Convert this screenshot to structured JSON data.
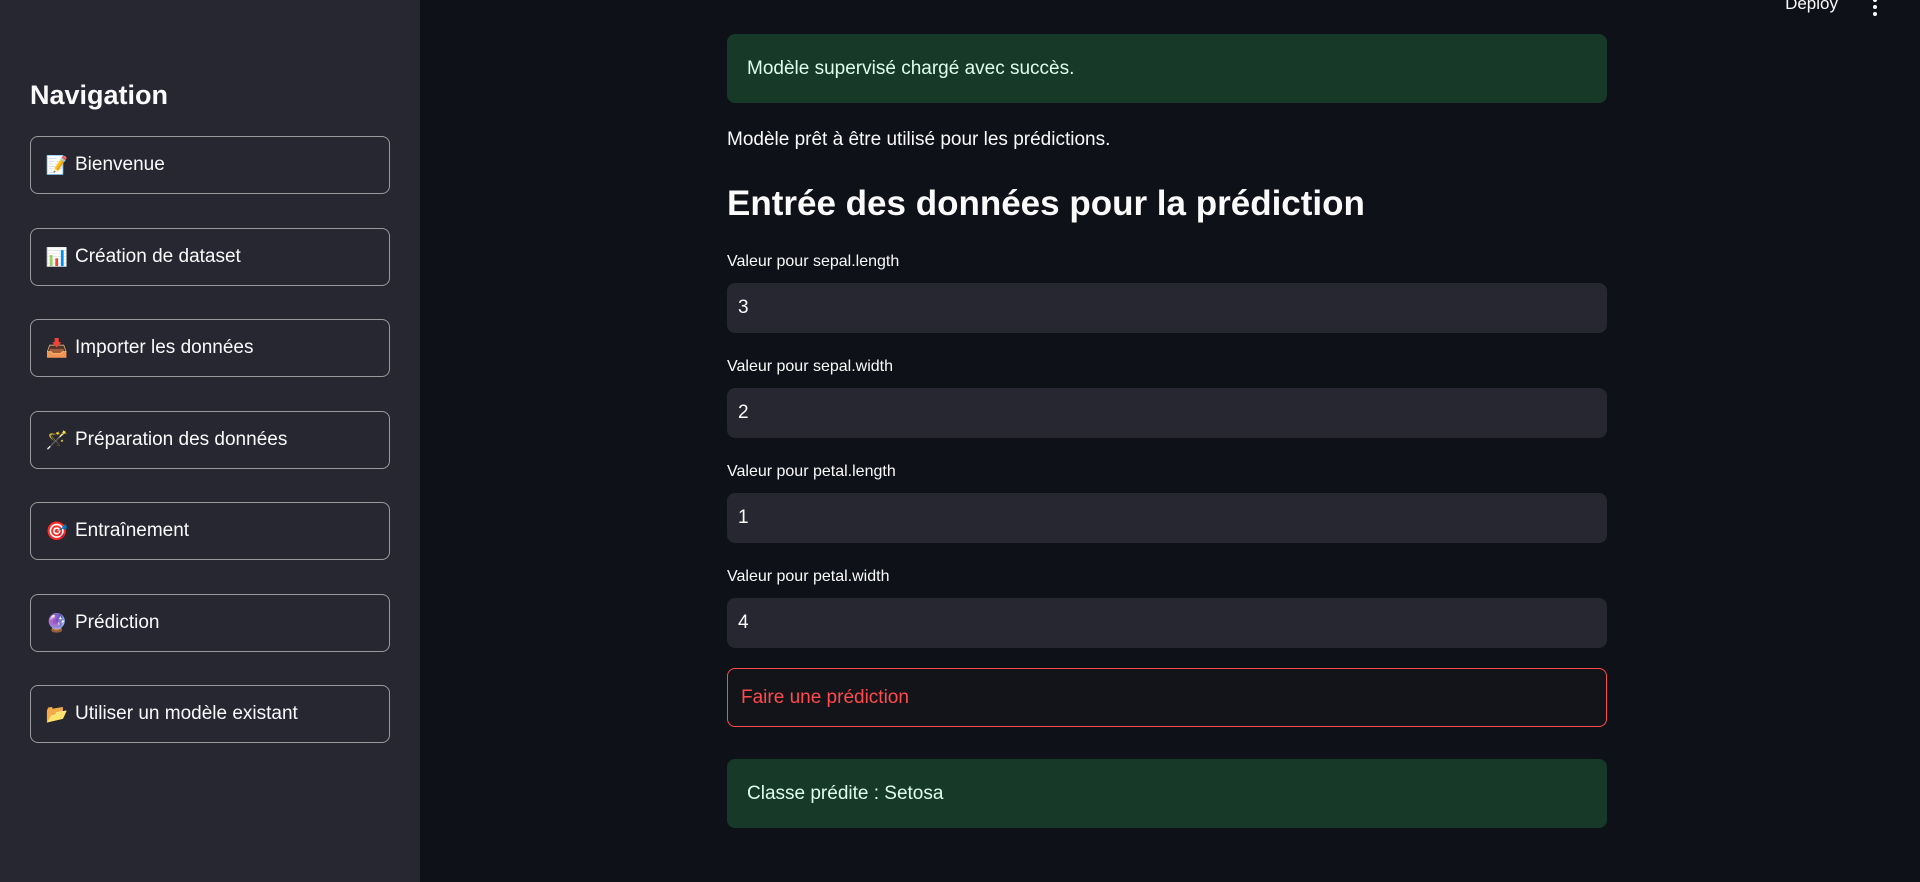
{
  "header": {
    "deploy_label": "Deploy",
    "menu_icon": "kebab-menu-icon"
  },
  "sidebar": {
    "title": "Navigation",
    "items": [
      {
        "icon": "📝",
        "icon_name": "memo-icon",
        "label": "Bienvenue"
      },
      {
        "icon": "📊",
        "icon_name": "bar-chart-icon",
        "label": "Création de dataset"
      },
      {
        "icon": "📥",
        "icon_name": "inbox-tray-icon",
        "label": "Importer les données"
      },
      {
        "icon": "🪄",
        "icon_name": "magic-wand-icon",
        "label": "Préparation des données"
      },
      {
        "icon": "🎯",
        "icon_name": "target-icon",
        "label": "Entraînement"
      },
      {
        "icon": "🔮",
        "icon_name": "crystal-ball-icon",
        "label": "Prédiction"
      },
      {
        "icon": "📂",
        "icon_name": "folder-icon",
        "label": "Utiliser un modèle existant"
      }
    ]
  },
  "main": {
    "success_message": "Modèle supervisé chargé avec succès.",
    "ready_text": "Modèle prêt à être utilisé pour les prédictions.",
    "heading": "Entrée des données pour la prédiction",
    "fields": [
      {
        "label": "Valeur pour sepal.length",
        "value": "3"
      },
      {
        "label": "Valeur pour sepal.width",
        "value": "2"
      },
      {
        "label": "Valeur pour petal.length",
        "value": "1"
      },
      {
        "label": "Valeur pour petal.width",
        "value": "4"
      }
    ],
    "predict_button": "Faire une prédiction",
    "result": "Classe prédite : Setosa"
  },
  "colors": {
    "background": "#0e1117",
    "sidebar": "#262730",
    "success_bg": "#173928",
    "success_text": "#dffde9",
    "primary": "#ff4b4b"
  }
}
